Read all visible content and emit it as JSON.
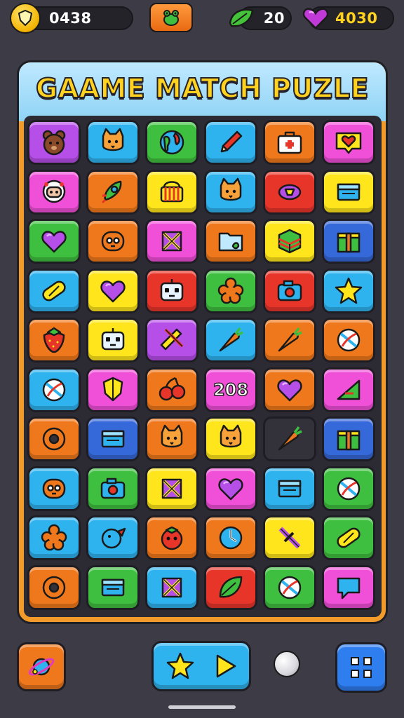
{
  "hud": {
    "timer": "0438",
    "timer_icon": "shield-icon",
    "center_icon": "frog-icon",
    "leaves_count": "20",
    "leaves_icon": "leaf-icon",
    "gems": "4030",
    "gems_icon": "heart-gem-icon"
  },
  "title": "GAAME MATCH PUZLE",
  "board": {
    "rows": [
      [
        {
          "color": "purple",
          "icon": "bear"
        },
        {
          "color": "blue",
          "icon": "cat"
        },
        {
          "color": "green",
          "icon": "globe"
        },
        {
          "color": "blue",
          "icon": "pencil"
        },
        {
          "color": "orange",
          "icon": "briefcase"
        },
        {
          "color": "magenta",
          "icon": "heart-sign"
        }
      ],
      [
        {
          "color": "magenta",
          "icon": "astronaut"
        },
        {
          "color": "orange",
          "icon": "rocket"
        },
        {
          "color": "yellow",
          "icon": "basket"
        },
        {
          "color": "blue",
          "icon": "cat"
        },
        {
          "color": "red",
          "icon": "candy"
        },
        {
          "color": "yellow",
          "icon": "box"
        }
      ],
      [
        {
          "color": "green",
          "icon": "heart"
        },
        {
          "color": "orange",
          "icon": "face"
        },
        {
          "color": "magenta",
          "icon": "cross"
        },
        {
          "color": "orange",
          "icon": "folder"
        },
        {
          "color": "yellow",
          "icon": "cube"
        },
        {
          "color": "navy",
          "icon": "gift"
        }
      ],
      [
        {
          "color": "blue",
          "icon": "capsule"
        },
        {
          "color": "yellow",
          "icon": "heart"
        },
        {
          "color": "red",
          "icon": "robot"
        },
        {
          "color": "green",
          "icon": "flower"
        },
        {
          "color": "red",
          "icon": "camera"
        },
        {
          "color": "blue",
          "icon": "star"
        }
      ],
      [
        {
          "color": "orange",
          "icon": "strawberry"
        },
        {
          "color": "yellow",
          "icon": "robot"
        },
        {
          "color": "purple",
          "icon": "tools"
        },
        {
          "color": "blue",
          "icon": "carrot"
        },
        {
          "color": "orange",
          "icon": "carrot"
        },
        {
          "color": "orange",
          "icon": "ball"
        }
      ],
      [
        {
          "color": "blue",
          "icon": "ball"
        },
        {
          "color": "magenta",
          "icon": "shield"
        },
        {
          "color": "orange",
          "icon": "cherries"
        },
        {
          "color": "magenta",
          "icon": "number",
          "text": "208"
        },
        {
          "color": "orange",
          "icon": "heart"
        },
        {
          "color": "magenta",
          "icon": "triangle"
        }
      ],
      [
        {
          "color": "orange",
          "icon": "donut"
        },
        {
          "color": "navy",
          "icon": "box"
        },
        {
          "color": "orange",
          "icon": "cat"
        },
        {
          "color": "yellow",
          "icon": "cat"
        },
        {
          "color": "dark",
          "icon": "carrot"
        },
        {
          "color": "navy",
          "icon": "gift"
        }
      ],
      [
        {
          "color": "blue",
          "icon": "face"
        },
        {
          "color": "green",
          "icon": "camera"
        },
        {
          "color": "yellow",
          "icon": "cross"
        },
        {
          "color": "magenta",
          "icon": "heart"
        },
        {
          "color": "blue",
          "icon": "box"
        },
        {
          "color": "green",
          "icon": "ball"
        }
      ],
      [
        {
          "color": "blue",
          "icon": "flower"
        },
        {
          "color": "blue",
          "icon": "bird"
        },
        {
          "color": "orange",
          "icon": "tomato"
        },
        {
          "color": "orange",
          "icon": "clock"
        },
        {
          "color": "yellow",
          "icon": "sword"
        },
        {
          "color": "green",
          "icon": "capsule"
        }
      ],
      [
        {
          "color": "orange",
          "icon": "donut"
        },
        {
          "color": "green",
          "icon": "box"
        },
        {
          "color": "blue",
          "icon": "cross"
        },
        {
          "color": "red",
          "icon": "leaf"
        },
        {
          "color": "green",
          "icon": "ball"
        },
        {
          "color": "magenta",
          "icon": "bubble"
        }
      ]
    ]
  },
  "bottom": {
    "left_icon": "planet-icon",
    "play_icons": [
      "star-icon",
      "play-icon"
    ],
    "dot_icon": "pearl-icon",
    "right_icon": "grid-icon"
  },
  "colors": {
    "background": "#3d3b46",
    "frame": "#f39b2a",
    "title": "#ffd21f",
    "purple": "#b64ee8",
    "magenta": "#f04fd7",
    "blue": "#2fb3ee",
    "green": "#3fbf3f",
    "orange": "#f0781c",
    "yellow": "#ffe61c",
    "red": "#e8352a",
    "navy": "#3568d8"
  }
}
